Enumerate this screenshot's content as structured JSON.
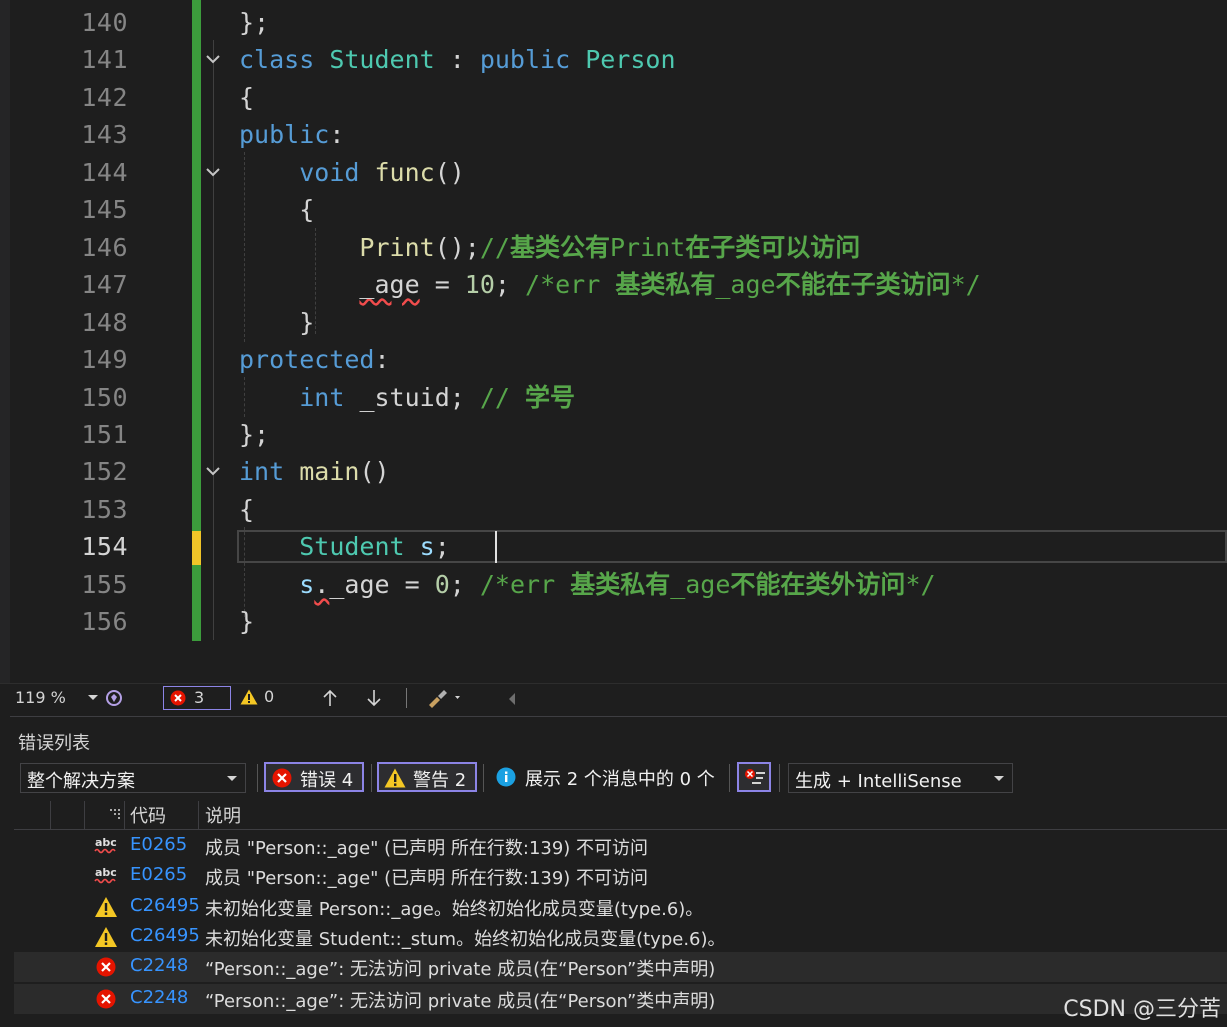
{
  "editor": {
    "lines": [
      {
        "num": "140",
        "tokens": [
          {
            "c": "pm",
            "t": "};"
          }
        ]
      },
      {
        "num": "141",
        "fold": true,
        "tokens": [
          {
            "c": "kw",
            "t": "class "
          },
          {
            "c": "ty",
            "t": "Student"
          },
          {
            "c": "pm",
            "t": " : "
          },
          {
            "c": "kw",
            "t": "public "
          },
          {
            "c": "ty",
            "t": "Person"
          }
        ]
      },
      {
        "num": "142",
        "tokens": [
          {
            "c": "pm",
            "t": "{"
          }
        ]
      },
      {
        "num": "143",
        "tokens": [
          {
            "c": "kw",
            "t": "public"
          },
          {
            "c": "pm",
            "t": ":"
          }
        ]
      },
      {
        "num": "144",
        "fold": true,
        "tokens": [
          {
            "c": "pm",
            "t": "    "
          },
          {
            "c": "kw",
            "t": "void "
          },
          {
            "c": "fn",
            "t": "func"
          },
          {
            "c": "pm",
            "t": "()"
          }
        ]
      },
      {
        "num": "145",
        "tokens": [
          {
            "c": "pm",
            "t": "    {"
          }
        ]
      },
      {
        "num": "146",
        "tokens": [
          {
            "c": "pm",
            "t": "        "
          },
          {
            "c": "fn",
            "t": "Print"
          },
          {
            "c": "pm",
            "t": "();"
          },
          {
            "c": "cm",
            "t": "//"
          },
          {
            "c": "cmz",
            "t": "基类公有"
          },
          {
            "c": "cm",
            "t": "Print"
          },
          {
            "c": "cmz",
            "t": "在子类可以访问"
          }
        ]
      },
      {
        "num": "147",
        "tokens": [
          {
            "c": "pm",
            "t": "        "
          },
          {
            "c": "pm squig",
            "t": "_age"
          },
          {
            "c": "pm",
            "t": " = "
          },
          {
            "c": "num",
            "t": "10"
          },
          {
            "c": "pm",
            "t": "; "
          },
          {
            "c": "cm",
            "t": "/*err "
          },
          {
            "c": "cmz",
            "t": "基类私有"
          },
          {
            "c": "cm",
            "t": "_age"
          },
          {
            "c": "cmz",
            "t": "不能在子类访问"
          },
          {
            "c": "cm",
            "t": "*/"
          }
        ]
      },
      {
        "num": "148",
        "tokens": [
          {
            "c": "pm",
            "t": "    }"
          }
        ]
      },
      {
        "num": "149",
        "tokens": [
          {
            "c": "kw",
            "t": "protected"
          },
          {
            "c": "pm",
            "t": ":"
          }
        ]
      },
      {
        "num": "150",
        "tokens": [
          {
            "c": "pm",
            "t": "    "
          },
          {
            "c": "kw",
            "t": "int "
          },
          {
            "c": "pm",
            "t": "_stuid; "
          },
          {
            "c": "cm",
            "t": "// "
          },
          {
            "c": "cmz",
            "t": "学号"
          }
        ]
      },
      {
        "num": "151",
        "tokens": [
          {
            "c": "pm",
            "t": "};"
          }
        ]
      },
      {
        "num": "152",
        "fold": true,
        "tokens": [
          {
            "c": "kw",
            "t": "int "
          },
          {
            "c": "fn",
            "t": "main"
          },
          {
            "c": "pm",
            "t": "()"
          }
        ]
      },
      {
        "num": "153",
        "tokens": [
          {
            "c": "pm",
            "t": "{"
          }
        ]
      },
      {
        "num": "154",
        "active": true,
        "tokens": [
          {
            "c": "pm",
            "t": "    "
          },
          {
            "c": "ty",
            "t": "Student"
          },
          {
            "c": "pm",
            "t": " "
          },
          {
            "c": "var",
            "t": "s"
          },
          {
            "c": "pm",
            "t": "; "
          }
        ]
      },
      {
        "num": "155",
        "tokens": [
          {
            "c": "pm",
            "t": "    "
          },
          {
            "c": "var",
            "t": "s"
          },
          {
            "c": "pm squig",
            "t": "."
          },
          {
            "c": "pm",
            "t": "_age = "
          },
          {
            "c": "num",
            "t": "0"
          },
          {
            "c": "pm",
            "t": "; "
          },
          {
            "c": "cm",
            "t": "/*err "
          },
          {
            "c": "cmz",
            "t": "基类私有"
          },
          {
            "c": "cm",
            "t": "_age"
          },
          {
            "c": "cmz",
            "t": "不能在类外访问"
          },
          {
            "c": "cm",
            "t": "*/"
          }
        ]
      },
      {
        "num": "156",
        "tokens": [
          {
            "c": "pm",
            "t": "}"
          }
        ]
      }
    ]
  },
  "statusbar": {
    "zoom": "119 %",
    "error_count": "3",
    "warning_count": "0"
  },
  "error_list": {
    "title": "错误列表",
    "scope": "整个解决方案",
    "errors_button": "错误 4",
    "warnings_button": "警告 2",
    "messages_text": "展示 2 个消息中的 0 个",
    "source": "生成 + IntelliSense",
    "col_code": "代码",
    "col_desc": "说明",
    "rows": [
      {
        "icon": "spell-error-icon",
        "code": "E0265",
        "desc": "成员 \"Person::_age\" (已声明 所在行数:139) 不可访问"
      },
      {
        "icon": "spell-error-icon",
        "code": "E0265",
        "desc": "成员 \"Person::_age\" (已声明 所在行数:139) 不可访问"
      },
      {
        "icon": "warning-icon",
        "code": "C26495",
        "desc": "未初始化变量 Person::_age。始终初始化成员变量(type.6)。"
      },
      {
        "icon": "warning-icon",
        "code": "C26495",
        "desc": "未初始化变量 Student::_stum。始终初始化成员变量(type.6)。"
      },
      {
        "icon": "error-icon",
        "code": "C2248",
        "desc": "“Person::_age”: 无法访问 private 成员(在“Person”类中声明)"
      },
      {
        "icon": "error-icon",
        "code": "C2248",
        "desc": "“Person::_age”: 无法访问 private 成员(在“Person”类中声明)"
      }
    ]
  },
  "watermark": "CSDN @三分苦"
}
